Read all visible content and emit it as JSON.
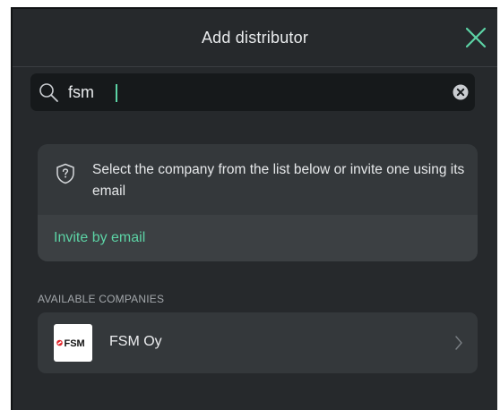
{
  "dialog": {
    "title": "Add distributor"
  },
  "search": {
    "value": "fsm",
    "placeholder": ""
  },
  "info": {
    "message": "Select the company from the list below or invite one using its email",
    "invite_label": "Invite by email"
  },
  "companies": {
    "section_label": "AVAILABLE COMPANIES",
    "items": [
      {
        "name": "FSM Oy",
        "logo_text": "FSM"
      }
    ]
  },
  "colors": {
    "background": "#26292c",
    "card": "#34383b",
    "accent": "#5cd3a5",
    "search_bg": "#16191b",
    "logo_red": "#e3262b"
  },
  "icons": [
    "close-icon",
    "search-icon",
    "clear-icon",
    "shield-question-icon",
    "chevron-right-icon"
  ]
}
